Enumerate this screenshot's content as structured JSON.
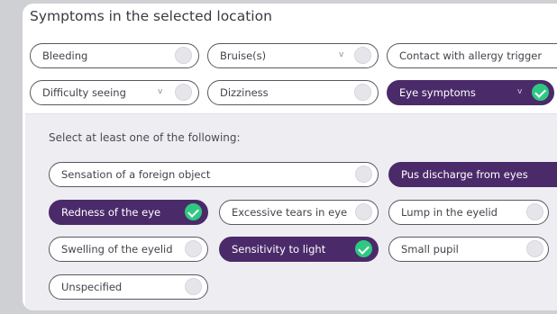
{
  "section": {
    "title": "Symptoms in the selected location"
  },
  "symptoms": [
    {
      "label": "Bleeding",
      "dropdown": false,
      "selected": false
    },
    {
      "label": "Bruise(s)",
      "dropdown": true,
      "selected": false
    },
    {
      "label": "Contact with allergy trigger",
      "dropdown": false,
      "selected": false
    },
    {
      "label": "Difficulty seeing",
      "dropdown": true,
      "selected": false
    },
    {
      "label": "Dizziness",
      "dropdown": false,
      "selected": false
    },
    {
      "label": "Eye symptoms",
      "dropdown": true,
      "selected": true
    }
  ],
  "sub": {
    "prompt": "Select at least one of the following:",
    "options": [
      {
        "label": "Sensation of a foreign object",
        "selected": false
      },
      {
        "label": "Pus discharge from eyes",
        "selected": true
      },
      {
        "label": "Redness of the eye",
        "selected": true
      },
      {
        "label": "Excessive tears in eye",
        "selected": false
      },
      {
        "label": "Lump in the eyelid",
        "selected": false
      },
      {
        "label": "Swelling of the eyelid",
        "selected": false
      },
      {
        "label": "Sensitivity to light",
        "selected": true
      },
      {
        "label": "Small pupil",
        "selected": false
      },
      {
        "label": "Unspecified",
        "selected": false
      }
    ]
  },
  "icons": {
    "dropdown": "chevron-down-icon",
    "checked": "check-circle-icon",
    "unchecked": "empty-circle-icon"
  },
  "colors": {
    "selected_chip": "#4b2a6a",
    "check": "#2fc882",
    "chip_border": "#585861"
  },
  "glyphs": {
    "chevron": "v"
  }
}
